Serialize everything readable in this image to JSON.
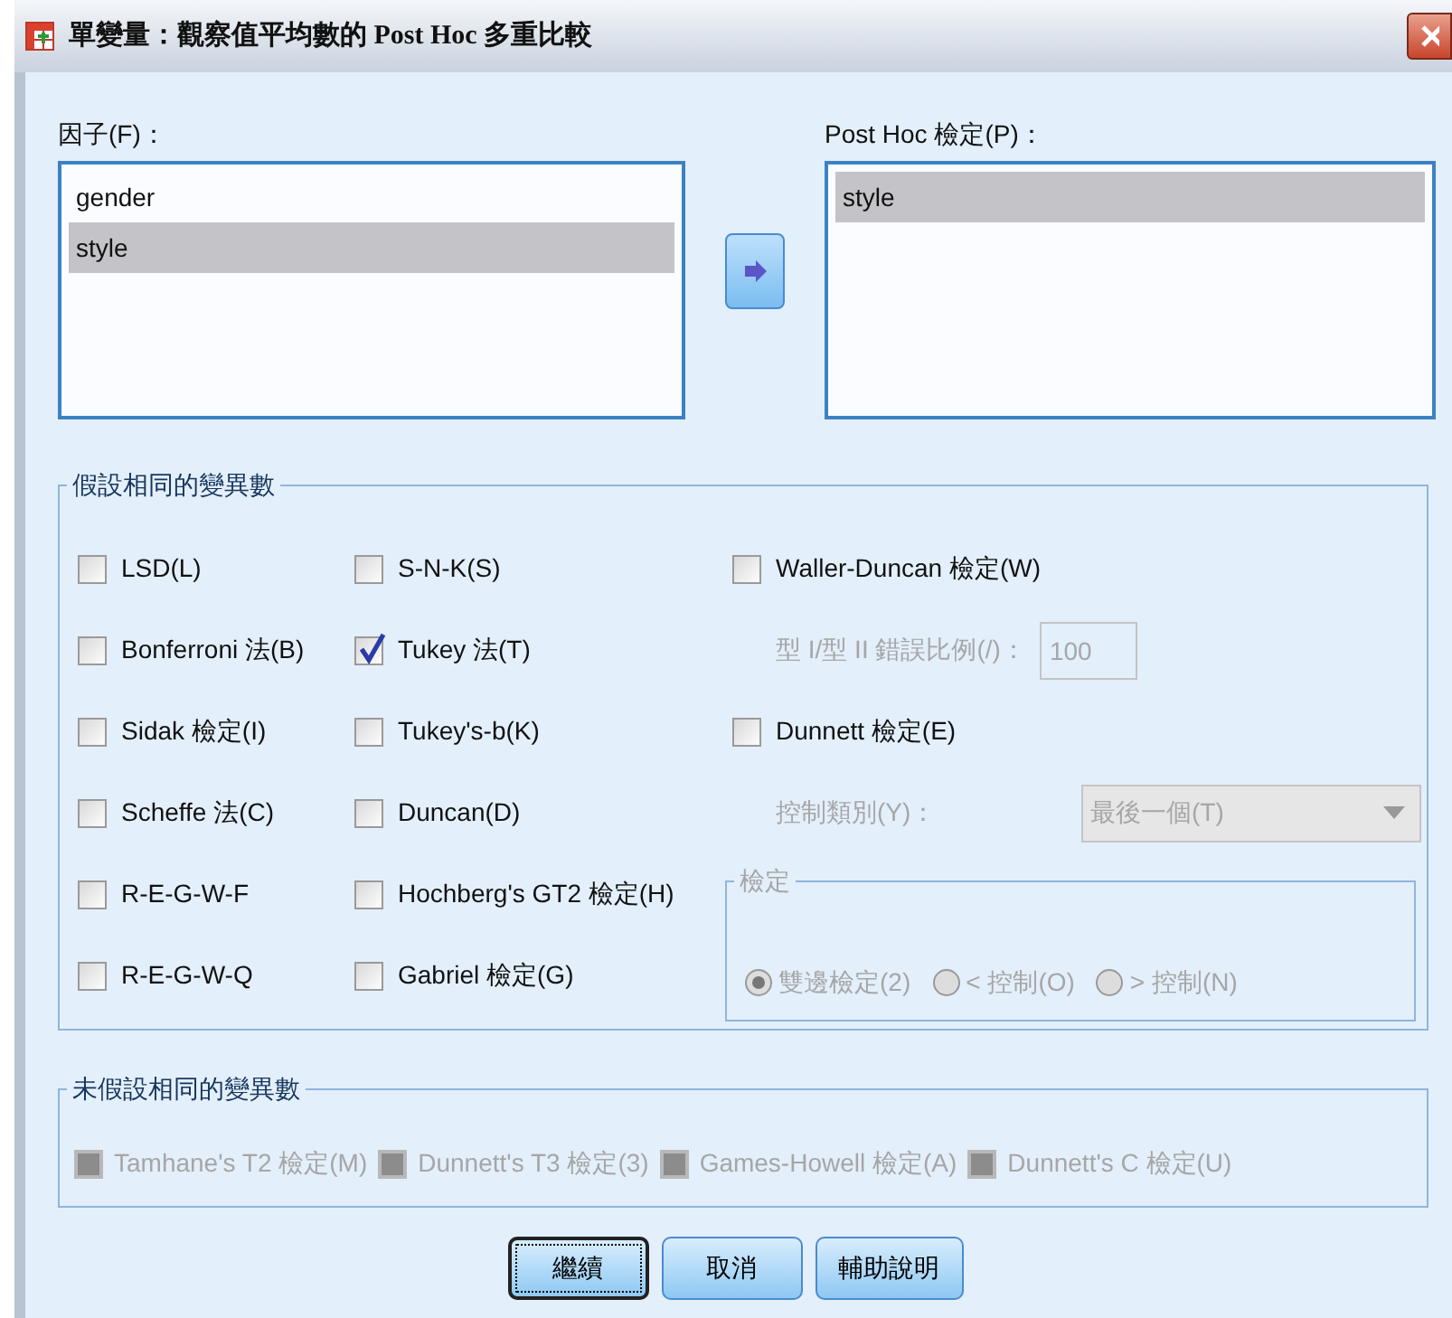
{
  "window": {
    "title": "單變量：觀察值平均數的 Post Hoc 多重比較"
  },
  "factors": {
    "label": "因子(F)：",
    "items": [
      {
        "text": "gender",
        "selected": false
      },
      {
        "text": "style",
        "selected": true
      }
    ]
  },
  "post_hoc": {
    "label": "Post Hoc 檢定(P)：",
    "items": [
      {
        "text": "style",
        "selected": true
      }
    ]
  },
  "equal_variances": {
    "title": "假設相同的變異數",
    "column_1": [
      {
        "label": "LSD(L)",
        "checked": false
      },
      {
        "label": "Bonferroni 法(B)",
        "checked": false
      },
      {
        "label": "Sidak 檢定(I)",
        "checked": false
      },
      {
        "label": "Scheffe 法(C)",
        "checked": false
      },
      {
        "label": "R-E-G-W-F",
        "checked": false
      },
      {
        "label": "R-E-G-W-Q",
        "checked": false
      }
    ],
    "column_2": [
      {
        "label": "S-N-K(S)",
        "checked": false
      },
      {
        "label": "Tukey 法(T)",
        "checked": true
      },
      {
        "label": "Tukey's-b(K)",
        "checked": false
      },
      {
        "label": "Duncan(D)",
        "checked": false
      },
      {
        "label": "Hochberg's GT2 檢定(H)",
        "checked": false
      },
      {
        "label": "Gabriel 檢定(G)",
        "checked": false
      }
    ],
    "waller_duncan": {
      "label": "Waller-Duncan 檢定(W)",
      "checked": false
    },
    "error_ratio": {
      "label": "型 I/型 II 錯誤比例(/)：",
      "value": "100",
      "disabled": true
    },
    "dunnett": {
      "label": "Dunnett 檢定(E)",
      "checked": false
    },
    "control_category": {
      "label": "控制類別(Y)：",
      "value": "最後一個(T)",
      "disabled": true
    },
    "test_group": {
      "title": "檢定",
      "disabled": true,
      "options": [
        {
          "label": "雙邊檢定(2)",
          "selected": true
        },
        {
          "label": "< 控制(O)",
          "selected": false
        },
        {
          "label": "> 控制(N)",
          "selected": false
        }
      ]
    }
  },
  "unequal_variances": {
    "title": "未假設相同的變異數",
    "tests": [
      {
        "label": "Tamhane's T2 檢定(M)",
        "checked": false,
        "disabled": true
      },
      {
        "label": "Dunnett's T3 檢定(3)",
        "checked": false,
        "disabled": true
      },
      {
        "label": "Games-Howell 檢定(A)",
        "checked": false,
        "disabled": true
      },
      {
        "label": "Dunnett's C 檢定(U)",
        "checked": false,
        "disabled": true
      }
    ]
  },
  "buttons": [
    {
      "label": "繼續",
      "focused": true
    },
    {
      "label": "取消",
      "focused": false
    },
    {
      "label": "輔助說明",
      "focused": false
    }
  ]
}
